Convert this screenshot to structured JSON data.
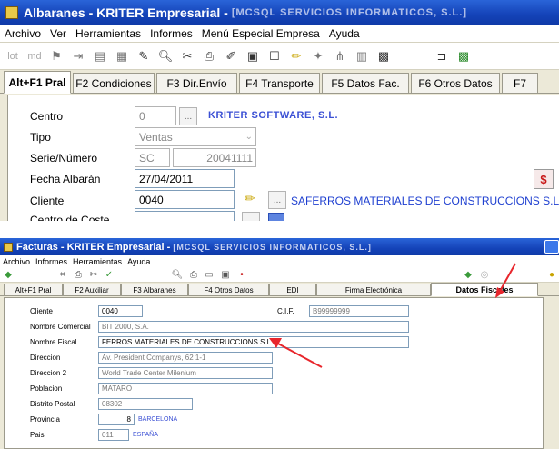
{
  "win1": {
    "title": "Albaranes - KRITER Empresarial - ",
    "title_blurred": "[MCSQL SERVICIOS INFORMATICOS, S.L.]",
    "menu": [
      "Archivo",
      "Ver",
      "Herramientas",
      "Informes",
      "Menú Especial Empresa",
      "Ayuda"
    ],
    "toolbar_icons": [
      "lot-icon",
      "md-icon",
      "flag-icon",
      "split-icon",
      "doc-icon",
      "grid-icon",
      "edit-icon",
      "preview-icon",
      "cut-icon",
      "print-icon",
      "brush-icon",
      "form-icon",
      "checkbox-icon",
      "pencil-icon",
      "pin-icon",
      "tree-icon",
      "export-icon",
      "calc-icon",
      "hang-icon",
      "box-icon"
    ],
    "toolbar_text": {
      "lot": "lot",
      "md": "md"
    },
    "tabs": [
      "Alt+F1 Pral",
      "F2 Condiciones",
      "F3 Dir.Envío",
      "F4 Transporte",
      "F5 Datos Fac.",
      "F6 Otros Datos",
      "F7"
    ],
    "fields": {
      "centro_label": "Centro",
      "centro_value": "0",
      "centro_name": "KRITER SOFTWARE, S.L.",
      "tipo_label": "Tipo",
      "tipo_value": "Ventas",
      "serie_label": "Serie/Número",
      "serie_value": "SC",
      "numero_value": "20041111",
      "fecha_label": "Fecha Albarán",
      "fecha_value": "27/04/2011",
      "cliente_label": "Cliente",
      "cliente_value": "0040",
      "cliente_name": "SAFERROS MATERIALES DE CONSTRUCCIONS S.L",
      "centro_coste_label": "Centro de Coste"
    },
    "lookup_button": "..."
  },
  "win2": {
    "title": "Facturas - KRITER Empresarial - ",
    "title_blurred": "[MCSQL SERVICIOS INFORMATICOS, S.L.]",
    "menu": [
      "Archivo",
      "Informes",
      "Herramientas",
      "Ayuda"
    ],
    "tabs": [
      "Alt+F1 Pral",
      "F2 Auxiliar",
      "F3 Albaranes",
      "F4 Otros Datos",
      "EDI",
      "Firma Electrónica",
      "Datos Fiscales"
    ],
    "fields": {
      "cliente_label": "Cliente",
      "cliente_value": "0040",
      "cif_label": "C.I.F.",
      "cif_value": "B99999999",
      "nombre_comercial_label": "Nombre Comercial",
      "nombre_comercial_value": "BIT 2000, S.A.",
      "nombre_fiscal_label": "Nombre Fiscal",
      "nombre_fiscal_value": "FERROS MATERIALES DE CONSTRUCCIONS S.L",
      "direccion_label": "Direccion",
      "direccion_value": "Av. President Companys, 62 1-1",
      "direccion2_label": "Direccion 2",
      "direccion2_value": "World Trade Center Milenium",
      "poblacion_label": "Poblacion",
      "poblacion_value": "MATARO",
      "distrito_label": "Distrito Postal",
      "distrito_value": "08302",
      "provincia_label": "Provincia",
      "provincia_code": "8",
      "provincia_name": "BARCELONA",
      "pais_label": "Pais",
      "pais_code": "011",
      "pais_name": "ESPAÑA"
    }
  },
  "colors": {
    "titlebar": "#1443b8",
    "arrow": "#e8262c",
    "link_blue": "#3a4fd4"
  }
}
